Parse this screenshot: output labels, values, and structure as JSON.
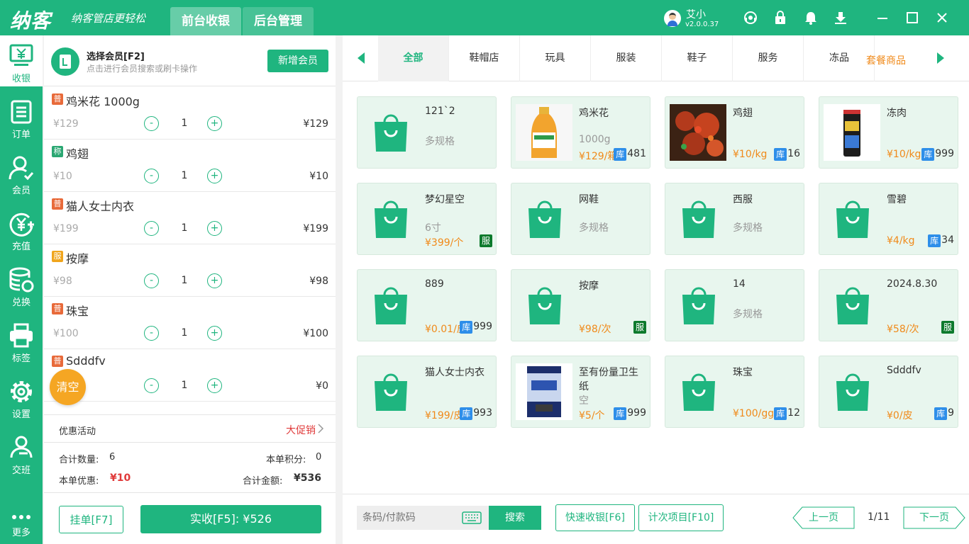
{
  "app": {
    "logo": "纳客",
    "slogan": "纳客管店更轻松",
    "tabs": [
      "前台收银",
      "后台管理"
    ]
  },
  "user": {
    "name": "艾小",
    "version": "v2.0.0.37"
  },
  "sidebar": {
    "items": [
      {
        "label": "收银",
        "icon": "cashier-icon"
      },
      {
        "label": "订单",
        "icon": "order-icon"
      },
      {
        "label": "会员",
        "icon": "member-icon"
      },
      {
        "label": "充值",
        "icon": "recharge-icon"
      },
      {
        "label": "兑换",
        "icon": "exchange-icon"
      },
      {
        "label": "标签",
        "icon": "printer-icon"
      },
      {
        "label": "设置",
        "icon": "gear-icon"
      },
      {
        "label": "交班",
        "icon": "handover-icon"
      },
      {
        "label": "更多",
        "icon": "more-icon"
      }
    ]
  },
  "member": {
    "title": "选择会员[F2]",
    "hint": "点击进行会员搜索或刷卡操作",
    "add_label": "新增会员"
  },
  "order_items": [
    {
      "badge": "普",
      "color": "red",
      "name": "鸡米花 1000g",
      "unit": "¥129",
      "qty": "1",
      "subtotal": "¥129"
    },
    {
      "badge": "称",
      "color": "green",
      "name": "鸡翅",
      "unit": "¥10",
      "qty": "1",
      "subtotal": "¥10"
    },
    {
      "badge": "普",
      "color": "red",
      "name": "猫人女士内衣",
      "unit": "¥199",
      "qty": "1",
      "subtotal": "¥199"
    },
    {
      "badge": "服",
      "color": "yellow",
      "name": "按摩",
      "unit": "¥98",
      "qty": "1",
      "subtotal": "¥98"
    },
    {
      "badge": "普",
      "color": "red",
      "name": "珠宝",
      "unit": "¥100",
      "qty": "1",
      "subtotal": "¥100"
    },
    {
      "badge": "普",
      "color": "red",
      "name": "Sdddfv",
      "unit": "",
      "qty": "1",
      "subtotal": "¥0"
    }
  ],
  "qty_minus": "-",
  "qty_plus": "+",
  "clear_label": "清空",
  "promo": {
    "label": "优惠活动",
    "value": "大促销"
  },
  "summary": {
    "count_label": "合计数量:",
    "count": "6",
    "points_label": "本单积分:",
    "points": "0",
    "discount_label": "本单优惠:",
    "discount": "¥10",
    "total_label": "合计金额:",
    "total": "¥536"
  },
  "actions": {
    "hold": "挂单[F7]",
    "pay": "实收[F5]: ¥526"
  },
  "categories": [
    "全部",
    "鞋帽店",
    "玩具",
    "服装",
    "鞋子",
    "服务",
    "冻品"
  ],
  "category_extra": "套餐商品",
  "products": [
    {
      "name": "121`2",
      "spec": "多规格",
      "price": "",
      "stock": "",
      "tag": "",
      "img": "bag"
    },
    {
      "name": "鸡米花",
      "spec": "1000g",
      "price": "¥129/箱",
      "stock": "481",
      "tag": "库",
      "img": "juice"
    },
    {
      "name": "鸡翅",
      "spec": "",
      "price": "¥10/kg",
      "stock": "16",
      "tag": "库",
      "img": "food"
    },
    {
      "name": "冻肉",
      "spec": "",
      "price": "¥10/kg",
      "stock": "999",
      "tag": "库",
      "img": "can"
    },
    {
      "name": "梦幻星空",
      "spec": "6寸",
      "price": "¥399/个",
      "stock": "",
      "tag": "服",
      "img": "bag"
    },
    {
      "name": "网鞋",
      "spec": "多规格",
      "price": "",
      "stock": "",
      "tag": "",
      "img": "bag"
    },
    {
      "name": "西服",
      "spec": "多规格",
      "price": "",
      "stock": "",
      "tag": "",
      "img": "bag"
    },
    {
      "name": "雪碧",
      "spec": "",
      "price": "¥4/kg",
      "stock": "34",
      "tag": "库",
      "img": "bag"
    },
    {
      "name": "889",
      "spec": "",
      "price": "¥0.01/皮",
      "stock": "999",
      "tag": "库",
      "img": "bag"
    },
    {
      "name": "按摩",
      "spec": "",
      "price": "¥98/次",
      "stock": "",
      "tag": "服",
      "img": "bag"
    },
    {
      "name": "14",
      "spec": "多规格",
      "price": "",
      "stock": "",
      "tag": "",
      "img": "bag"
    },
    {
      "name": "2024.8.30",
      "spec": "",
      "price": "¥58/次",
      "stock": "",
      "tag": "服",
      "img": "bag"
    },
    {
      "name": "猫人女士内衣",
      "spec": "",
      "price": "¥199/皮",
      "stock": "993",
      "tag": "库",
      "img": "bag"
    },
    {
      "name": "至有份量卫生纸",
      "spec": "空",
      "price": "¥5/个",
      "stock": "999",
      "tag": "库",
      "img": "paper"
    },
    {
      "name": "珠宝",
      "spec": "",
      "price": "¥100/gg",
      "stock": "12",
      "tag": "库",
      "img": "bag"
    },
    {
      "name": "Sdddfv",
      "spec": "",
      "price": "¥0/皮",
      "stock": "9",
      "tag": "库",
      "img": "bag"
    }
  ],
  "bottom": {
    "search_placeholder": "条码/付款码",
    "search_label": "搜索",
    "quick": "快速收银[F6]",
    "count_items": "计次项目[F10]",
    "prev": "上一页",
    "page": "1/11",
    "next": "下一页"
  },
  "colors": {
    "brand": "#1fb57f",
    "price": "#f08a1a",
    "alert": "#e03a3a",
    "clear": "#f5a623"
  }
}
